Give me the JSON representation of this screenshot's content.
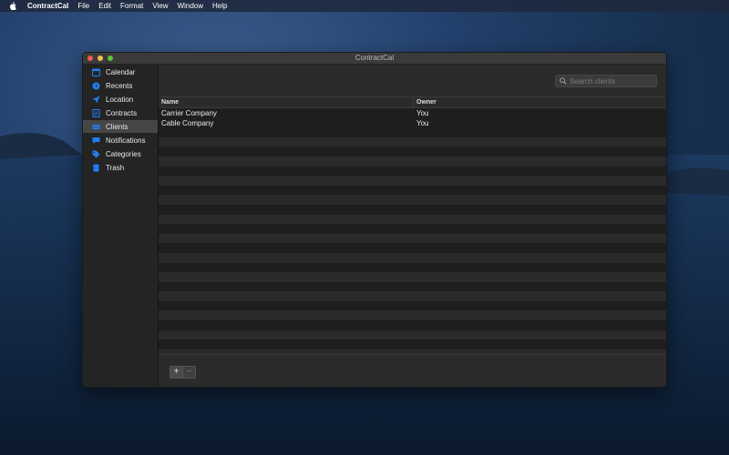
{
  "menubar": {
    "app_name": "ContractCal",
    "items": [
      "File",
      "Edit",
      "Format",
      "View",
      "Window",
      "Help"
    ]
  },
  "window": {
    "title": "ContractCal"
  },
  "sidebar": {
    "items": [
      {
        "label": "Calendar",
        "icon": "calendar-icon"
      },
      {
        "label": "Recents",
        "icon": "clock-icon"
      },
      {
        "label": "Location",
        "icon": "location-arrow-icon"
      },
      {
        "label": "Contracts",
        "icon": "document-icon"
      },
      {
        "label": "Clients",
        "icon": "card-icon",
        "selected": true
      },
      {
        "label": "Notifications",
        "icon": "speech-bubble-icon"
      },
      {
        "label": "Categories",
        "icon": "tag-icon"
      },
      {
        "label": "Trash",
        "icon": "trash-icon"
      }
    ]
  },
  "search": {
    "placeholder": "Search clients",
    "value": ""
  },
  "table": {
    "columns": [
      "Name",
      "Owner"
    ],
    "rows": [
      [
        "Carrier Company",
        "You"
      ],
      [
        "Cable Company",
        "You"
      ]
    ]
  },
  "footer": {
    "add_label": "+",
    "remove_label": "−"
  },
  "colors": {
    "accent": "#1f7ff0",
    "sidebar_bg": "#242424",
    "selected_bg": "#464646"
  }
}
